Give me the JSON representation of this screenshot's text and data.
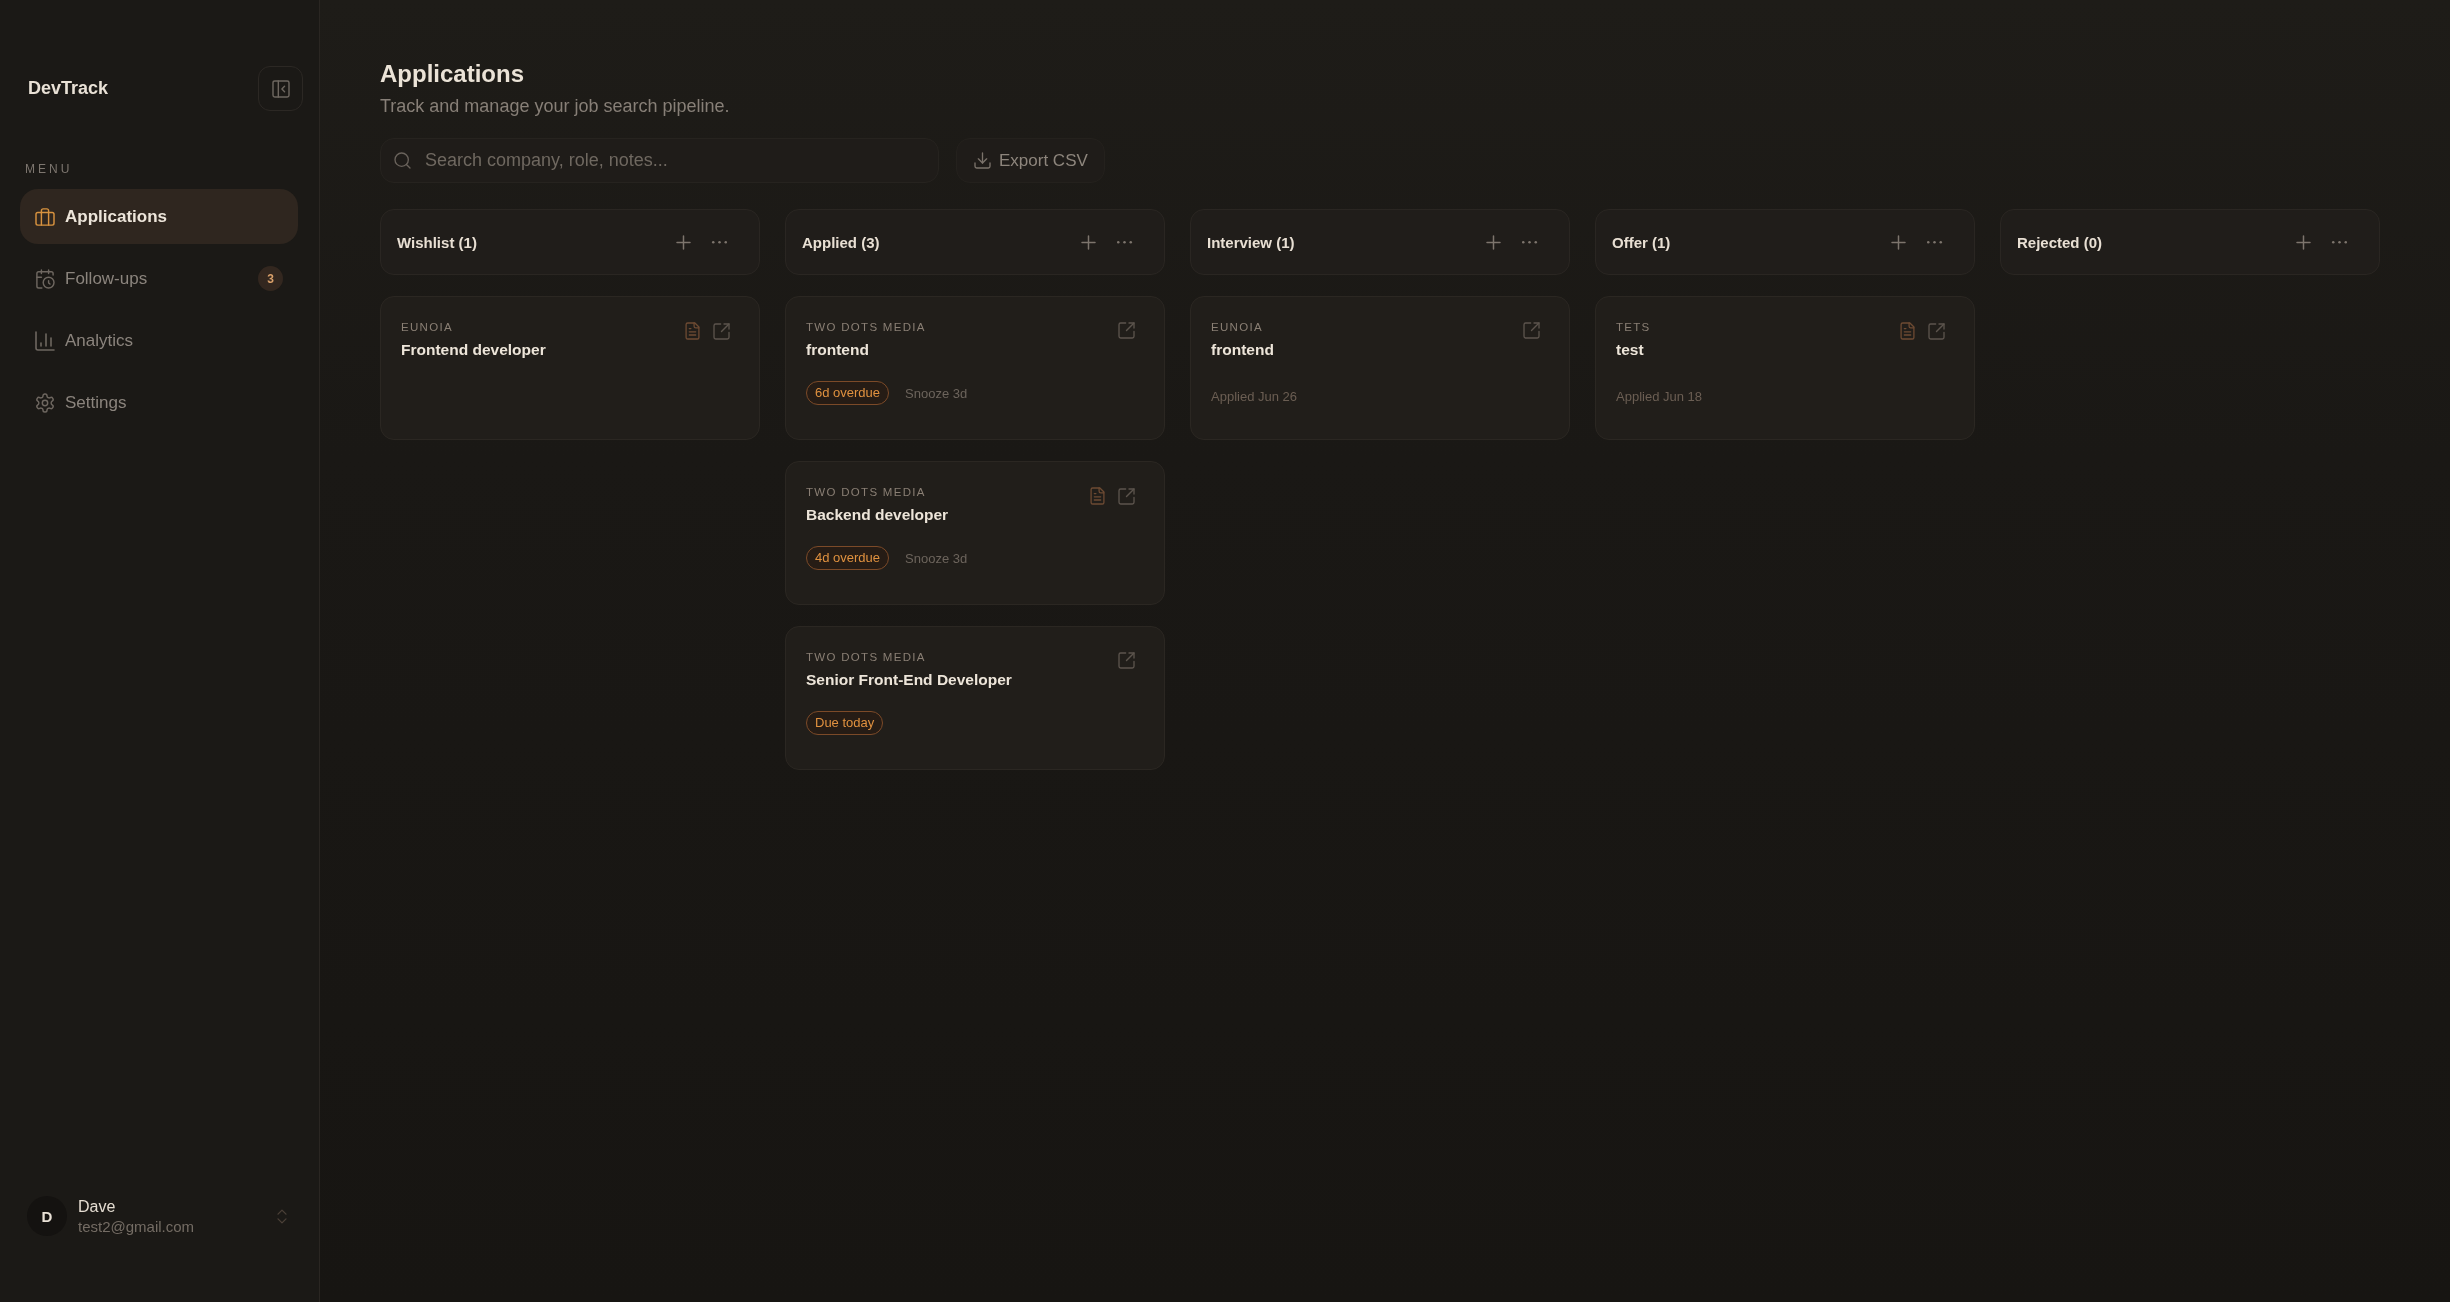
{
  "sidebar": {
    "brand": "DevTrack",
    "menu_label": "MENU",
    "nav": [
      {
        "label": "Applications",
        "selected": true
      },
      {
        "label": "Follow-ups",
        "selected": false,
        "badge": "3"
      },
      {
        "label": "Analytics",
        "selected": false
      },
      {
        "label": "Settings",
        "selected": false
      }
    ],
    "user": {
      "initial": "D",
      "name": "Dave",
      "email": "test2@gmail.com"
    }
  },
  "page": {
    "title": "Applications",
    "subtitle": "Track and manage your job search pipeline."
  },
  "search": {
    "placeholder": "Search company, role, notes..."
  },
  "export_button": "Export CSV",
  "columns": [
    {
      "title": "Wishlist (1)",
      "cards": [
        {
          "company": "EUNOIA",
          "role": "Frontend developer",
          "notes": true
        }
      ]
    },
    {
      "title": "Applied (3)",
      "cards": [
        {
          "company": "TWO DOTS MEDIA",
          "role": "frontend",
          "notes": false,
          "follow_up": {
            "label": "6d overdue",
            "snooze": "Snooze 3d"
          }
        },
        {
          "company": "TWO DOTS MEDIA",
          "role": "Backend developer",
          "notes": true,
          "follow_up": {
            "label": "4d overdue",
            "snooze": "Snooze 3d"
          }
        },
        {
          "company": "TWO DOTS MEDIA",
          "role": "Senior Front-End Developer",
          "notes": false,
          "follow_up": {
            "label": "Due today"
          }
        }
      ]
    },
    {
      "title": "Interview (1)",
      "cards": [
        {
          "company": "EUNOIA",
          "role": "frontend",
          "notes": false,
          "applied": "Applied Jun 26"
        }
      ]
    },
    {
      "title": "Offer (1)",
      "cards": [
        {
          "company": "TETS",
          "role": "test",
          "notes": true,
          "applied": "Applied Jun 18"
        }
      ]
    },
    {
      "title": "Rejected (0)"
    }
  ]
}
